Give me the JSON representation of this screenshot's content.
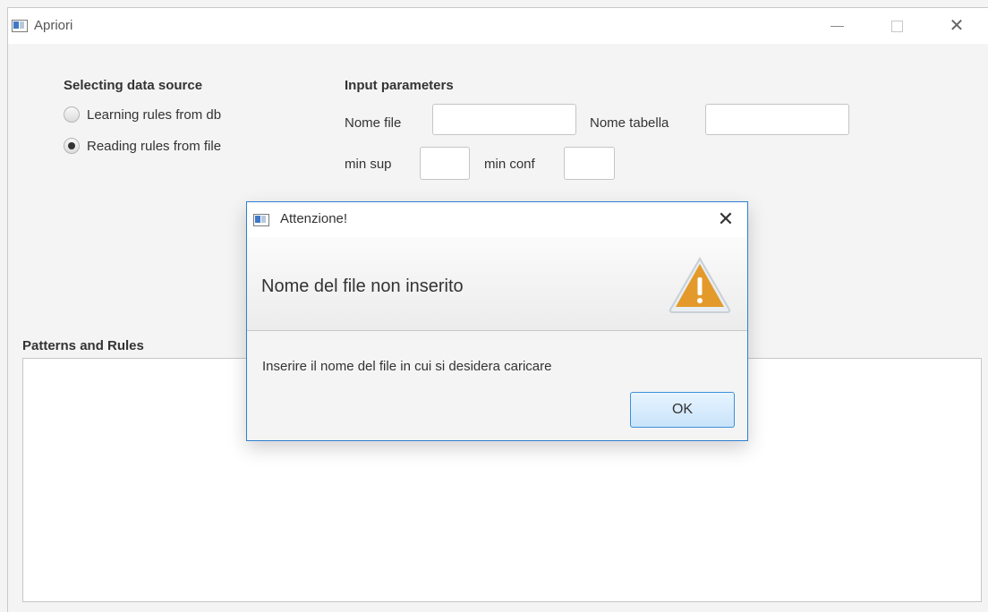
{
  "window": {
    "title": "Apriori",
    "icons": {
      "app": "app-window-icon",
      "minimize": "minimize-icon",
      "maximize": "maximize-icon",
      "close": "close-icon"
    }
  },
  "data_source": {
    "heading": "Selecting data source",
    "options": [
      {
        "label": "Learning rules from db",
        "checked": false
      },
      {
        "label": "Reading rules from file",
        "checked": true
      }
    ]
  },
  "parameters": {
    "heading": "Input parameters",
    "file_name_label": "Nome file",
    "file_name_value": "",
    "table_name_label": "Nome tabella",
    "table_name_value": "",
    "min_sup_label": "min sup",
    "min_sup_value": "",
    "min_conf_label": "min conf",
    "min_conf_value": ""
  },
  "output": {
    "heading": "Patterns and Rules",
    "content": ""
  },
  "dialog": {
    "title": "Attenzione!",
    "header": "Nome del file non inserito",
    "content": "Inserire il nome del file in cui si desidera caricare",
    "ok_label": "OK",
    "warning_color": "#e49a2a"
  }
}
